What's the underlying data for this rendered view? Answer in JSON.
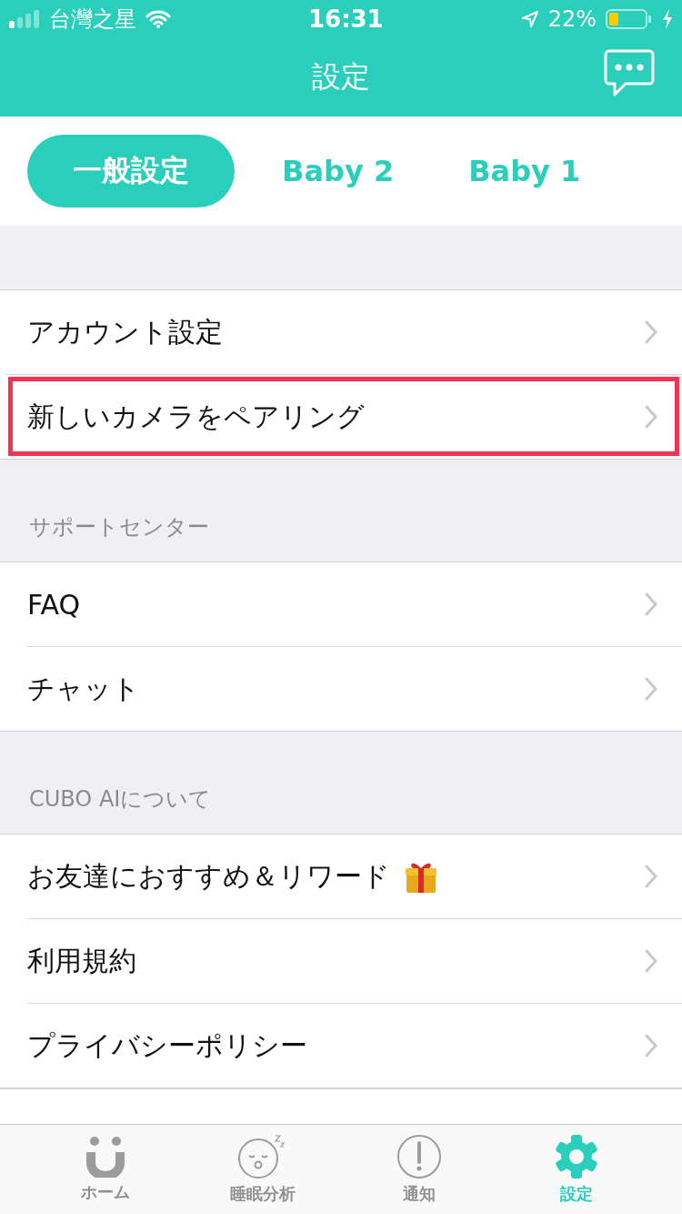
{
  "status_bar": {
    "carrier": "台灣之星",
    "time": "16:31",
    "battery": "22%"
  },
  "header": {
    "title": "設定"
  },
  "tabs": [
    {
      "label": "一般設定",
      "selected": true
    },
    {
      "label": "Baby 2",
      "selected": false
    },
    {
      "label": "Baby 1",
      "selected": false
    }
  ],
  "sections": [
    {
      "items": [
        {
          "label": "アカウント設定",
          "highlighted": false
        },
        {
          "label": "新しいカメラをペアリング",
          "highlighted": true
        }
      ]
    },
    {
      "header": "サポートセンター",
      "items": [
        {
          "label": "FAQ",
          "highlighted": false
        },
        {
          "label": "チャット",
          "highlighted": false
        }
      ]
    },
    {
      "header": "CUBO AIについて",
      "items": [
        {
          "label": "お友達におすすめ＆リワード",
          "highlighted": false,
          "gift": true
        },
        {
          "label": "利用規約",
          "highlighted": false
        },
        {
          "label": "プライバシーポリシー",
          "highlighted": false
        }
      ]
    }
  ],
  "tab_bar": [
    {
      "kind": "home",
      "label": "ホーム",
      "selected": false
    },
    {
      "kind": "sleep",
      "label": "睡眠分析",
      "selected": false
    },
    {
      "kind": "alert",
      "label": "通知",
      "selected": false
    },
    {
      "kind": "settings",
      "label": "設定",
      "selected": true
    }
  ]
}
